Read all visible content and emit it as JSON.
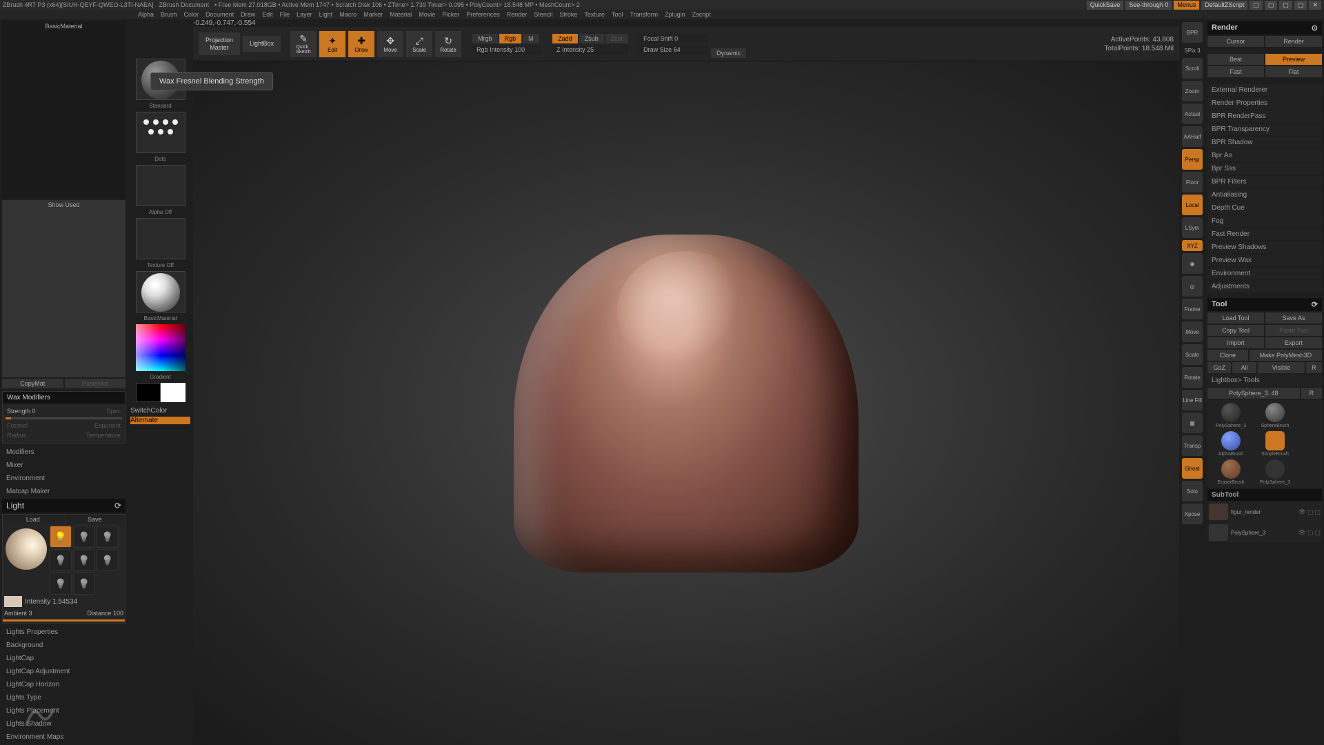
{
  "title_bar": {
    "app": "ZBrush 4R7 P3 (x64)[SIUH-QEYF-QWEO-L3TI-NAEA]",
    "doc": "ZBrush Document",
    "stats": "• Free Mem 27.018GB • Active Mem 1747 • Scratch Disk 106 • ZTime> 1.739 Timer> 0.095 • PolyCount> 18.548 MP • MeshCount> 2",
    "quicksave": "QuickSave",
    "seethrough": "See-through  0",
    "menus": "Menus",
    "script": "DefaultZScript"
  },
  "menu_bar": [
    "Alpha",
    "Brush",
    "Color",
    "Document",
    "Draw",
    "Edit",
    "File",
    "Layer",
    "Light",
    "Macro",
    "Marker",
    "Material",
    "Movie",
    "Picker",
    "Preferences",
    "Render",
    "Stencil",
    "Stroke",
    "Texture",
    "Tool",
    "Transform",
    "Zplugin",
    "Zscript"
  ],
  "coords": "-0.249,-0.747,-0.554",
  "tooltip": "Wax Fresnel Blending Strength",
  "left": {
    "material": "BasicMaterial",
    "show_used": "Show Used",
    "copymat": "CopyMat",
    "pastemat": "PasteMat",
    "wax_modifiers": "Wax Modifiers",
    "strength": "Strength 0",
    "spec": "Spec",
    "fresnel": "Fresnel",
    "exponent": "Exponent",
    "radius": "Radius",
    "temperature": "Temperature",
    "modifiers": "Modifiers",
    "mixer": "Mixer",
    "environment": "Environment",
    "matcap_maker": "Matcap Maker",
    "light": "Light",
    "load": "Load",
    "save": "Save",
    "intensity": "Intensity 1.54534",
    "ambient": "Ambient 3",
    "distance": "Distance 100",
    "light_items": [
      "Lights Properties",
      "Background",
      "LightCap",
      "LightCap Adjustment",
      "LightCap Horizon",
      "Lights Type",
      "Lights Placement",
      "Lights Shadow",
      "Environment Maps"
    ]
  },
  "tool_col": {
    "standard": "Standard",
    "dots": "Dots",
    "alpha_off": "Alpha Off",
    "texture_off": "Texture Off",
    "basic_material": "BasicMaterial",
    "gradient": "Gradient",
    "switch_color": "SwitchColor",
    "alternate": "Alternate"
  },
  "toolbar": {
    "projection_master": "Projection\nMaster",
    "lightbox": "LightBox",
    "quick_sketch": "Quick\nSketch",
    "edit": "Edit",
    "draw": "Draw",
    "move": "Move",
    "scale": "Scale",
    "rotate": "Rotate",
    "mrgb": "Mrgb",
    "rgb": "Rgb",
    "m": "M",
    "rgb_intensity": "Rgb Intensity 100",
    "zadd": "Zadd",
    "zsub": "Zsub",
    "zcut": "Zcut",
    "z_intensity": "Z Intensity 25",
    "focal_shift": "Focal Shift 0",
    "draw_size": "Draw Size 64",
    "dynamic": "Dynamic",
    "active_points": "ActivePoints: 43,808",
    "total_points": "TotalPoints: 18.548 Mil"
  },
  "right_icons": [
    "BPR",
    "SPix 3",
    "Scroll",
    "Zoom",
    "Actual",
    "AAHalf",
    "Persp",
    "Floor",
    "Local",
    "LSym",
    "XYZ",
    "",
    "",
    "Frame",
    "Move",
    "Scale",
    "Rotate",
    "Line Fill",
    "",
    "Transp",
    "Ghost",
    "Solo",
    "Xpose"
  ],
  "right": {
    "render": "Render",
    "cursor": "Cursor",
    "render_btn": "Render",
    "best": "Best",
    "preview": "Preview",
    "fast": "Fast",
    "flat": "Flat",
    "render_items": [
      "External Renderer",
      "Render Properties",
      "BPR RenderPass",
      "BPR Transparency",
      "BPR Shadow",
      "Bpr Ao",
      "Bpr Sss",
      "BPR Filters",
      "Antialiasing",
      "Depth Cue",
      "Fog",
      "Fast Render",
      "Preview Shadows",
      "Preview Wax",
      "Environment",
      "Adjustments"
    ],
    "tool": "Tool",
    "load_tool": "Load Tool",
    "save_as": "Save As",
    "copy_tool": "Copy Tool",
    "paste_tool": "Paste Tool",
    "import": "Import",
    "export": "Export",
    "clone": "Clone",
    "make_polymesh": "Make PolyMesh3D",
    "goz": "GoZ",
    "all": "All",
    "visible": "Visible",
    "r": "R",
    "lightbox_tools": "Lightbox> Tools",
    "active_tool": "PolySphere_3. 48",
    "tools": [
      {
        "name": "PolySphere_3"
      },
      {
        "name": "SphereBrush"
      },
      {
        "name": "AlphaBrush"
      },
      {
        "name": "SimpleBrush"
      },
      {
        "name": "EraserBrush"
      },
      {
        "name": "PolySphere_3"
      }
    ],
    "subtool": "SubTool",
    "subtools": [
      {
        "name": "figur_render"
      },
      {
        "name": "PolySphere_3"
      }
    ]
  }
}
